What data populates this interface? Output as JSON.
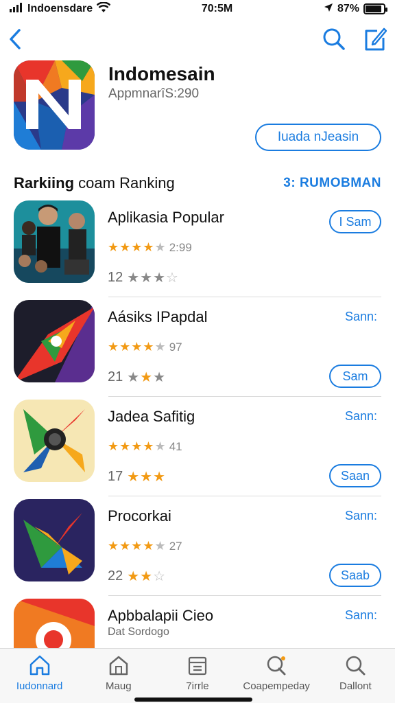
{
  "status": {
    "carrier": "Indoensdare",
    "time": "70:5M",
    "battery": "87%"
  },
  "hero": {
    "title": "Indomesain",
    "subtitle": "AppmnarîS:290",
    "button": "Iuada nJeasin"
  },
  "section": {
    "title_bold": "Rarkiing",
    "title_rest": "coam Ranking",
    "link": "3: RUMOBMAN"
  },
  "apps": [
    {
      "title": "Aplikasia Popular",
      "rating_text": "2:99",
      "stars": 4.5,
      "count": "12",
      "count_stars": 3.5,
      "action": "I Sam",
      "action_style": "outline"
    },
    {
      "title": "Aásiks IPapdal",
      "rating_text": "97",
      "stars": 4.5,
      "count": "21",
      "count_stars": 3,
      "action_link": "Sann:",
      "action": "Sam",
      "action_style": "both"
    },
    {
      "title": "Jadea Safitig",
      "rating_text": "41",
      "stars": 4.5,
      "count": "17",
      "count_stars": 3,
      "action_link": "Sann:",
      "action": "Saan",
      "action_style": "both"
    },
    {
      "title": "Procorkai",
      "rating_text": "27",
      "stars": 4.5,
      "count": "22",
      "count_stars": 3,
      "action_link": "Sann:",
      "action": "Saab",
      "action_style": "both"
    },
    {
      "title": "Apbbalapii Cieo",
      "subtitle": "Dat Sordogo",
      "action_link": "Sann:"
    }
  ],
  "tabs": [
    {
      "label": "Iudonnard",
      "icon": "home-icon",
      "active": true
    },
    {
      "label": "Maug",
      "icon": "house-outline-icon"
    },
    {
      "label": "7irrle",
      "icon": "list-icon"
    },
    {
      "label": "Coapempeday",
      "icon": "search-bubble-icon"
    },
    {
      "label": "Dallont",
      "icon": "search-icon"
    }
  ],
  "colors": {
    "accent": "#1a7ce0",
    "star": "#f29a14"
  }
}
